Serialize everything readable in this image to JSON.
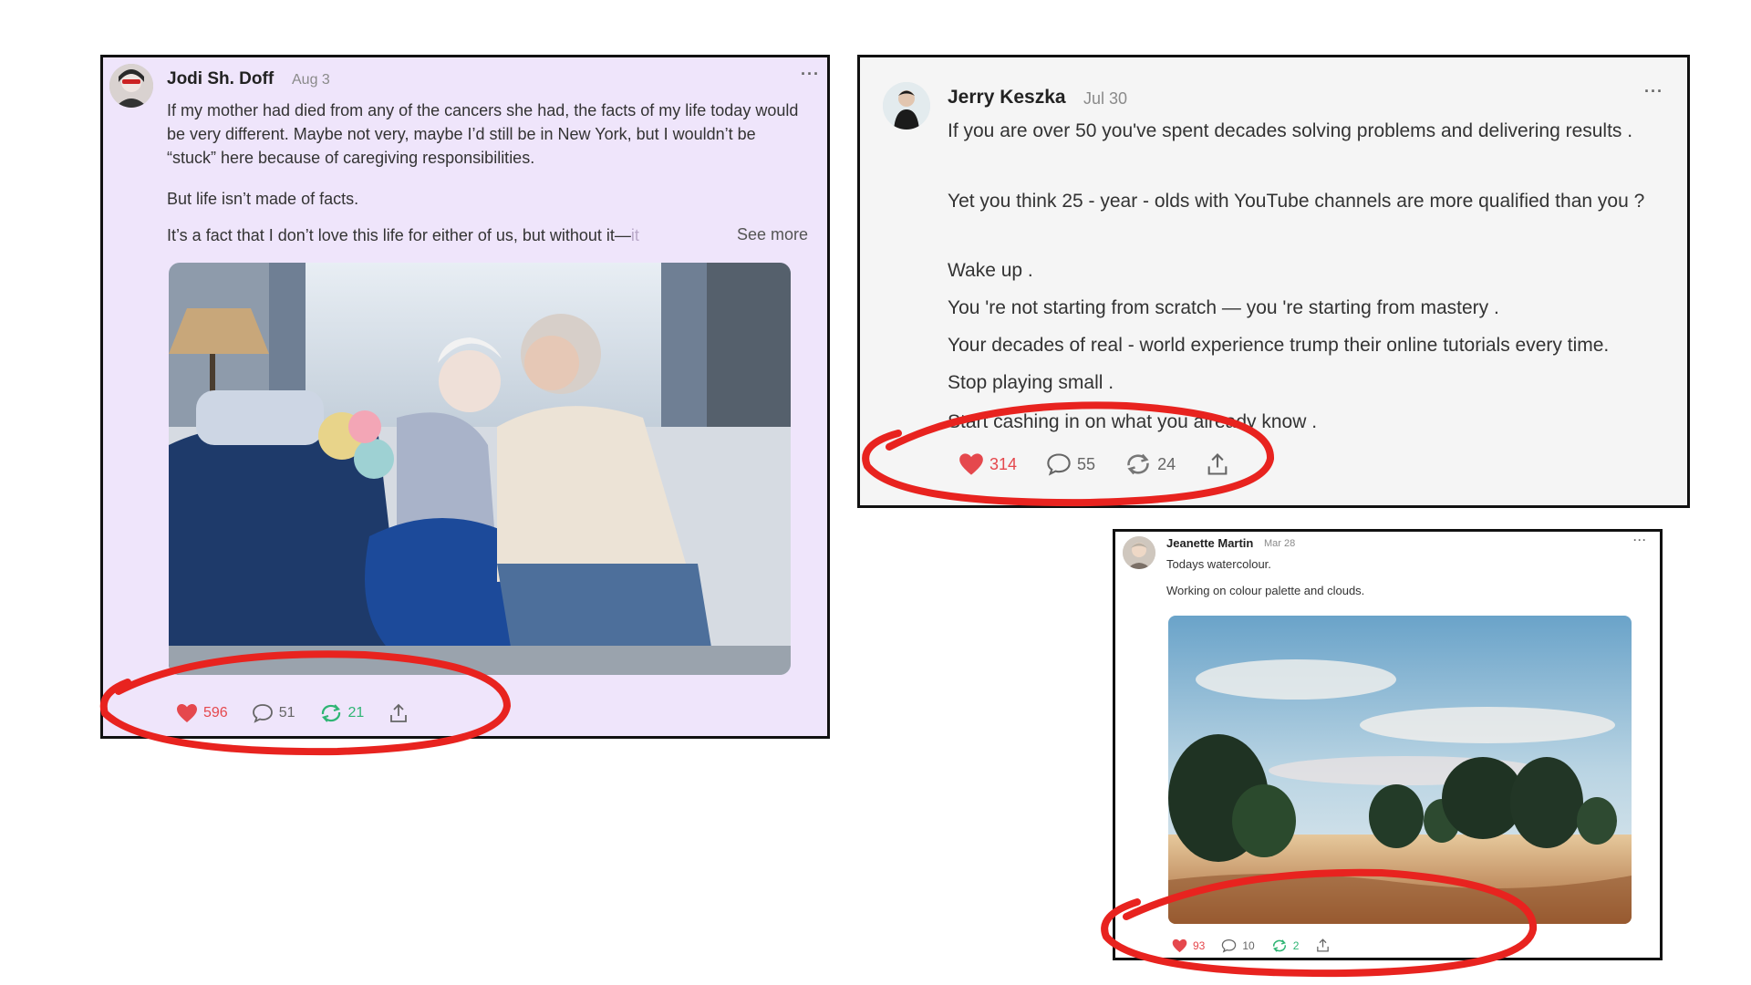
{
  "posts": [
    {
      "author": "Jodi Sh. Doff",
      "date": "Aug 3",
      "more": "···",
      "paragraphs": [
        "If my mother had died from any of the cancers she had, the facts of my life today would be very different. Maybe not very, maybe I’d still be in New York, but I wouldn’t be “stuck” here because of caregiving responsibilities.",
        "But life isn’t made of facts."
      ],
      "last_line_visible": "It’s a fact that I don’t love this life for either of us, but without it—",
      "last_line_faded": "it",
      "see_more": "See more",
      "likes": "596",
      "comments": "51",
      "reposts": "21"
    },
    {
      "author": "Jerry Keszka",
      "date": "Jul 30",
      "more": "···",
      "paragraphs": [
        "If you are over 50 you've spent decades solving problems and delivering results .",
        "Yet you think 25 - year - olds with YouTube channels are more qualified than you ?",
        "Wake up .",
        "You 're not starting from scratch — you 're starting from mastery .",
        "Your decades of real - world experience trump their online tutorials every time.",
        "Stop playing small .",
        "Start cashing in on what you already know ."
      ],
      "likes": "314",
      "comments": "55",
      "reposts": "24"
    },
    {
      "author": "Jeanette Martin",
      "date": "Mar 28",
      "more": "···",
      "paragraphs": [
        "Todays watercolour.",
        "Working on colour palette and clouds."
      ],
      "likes": "93",
      "comments": "10",
      "reposts": "2"
    }
  ],
  "colors": {
    "like": "#e5484d",
    "repost": "#2fb574",
    "annotation": "#e8231f",
    "card1_bg": "#efe5fb"
  },
  "icons": [
    "heart-icon",
    "comment-icon",
    "repost-icon",
    "share-icon",
    "more-icon"
  ]
}
